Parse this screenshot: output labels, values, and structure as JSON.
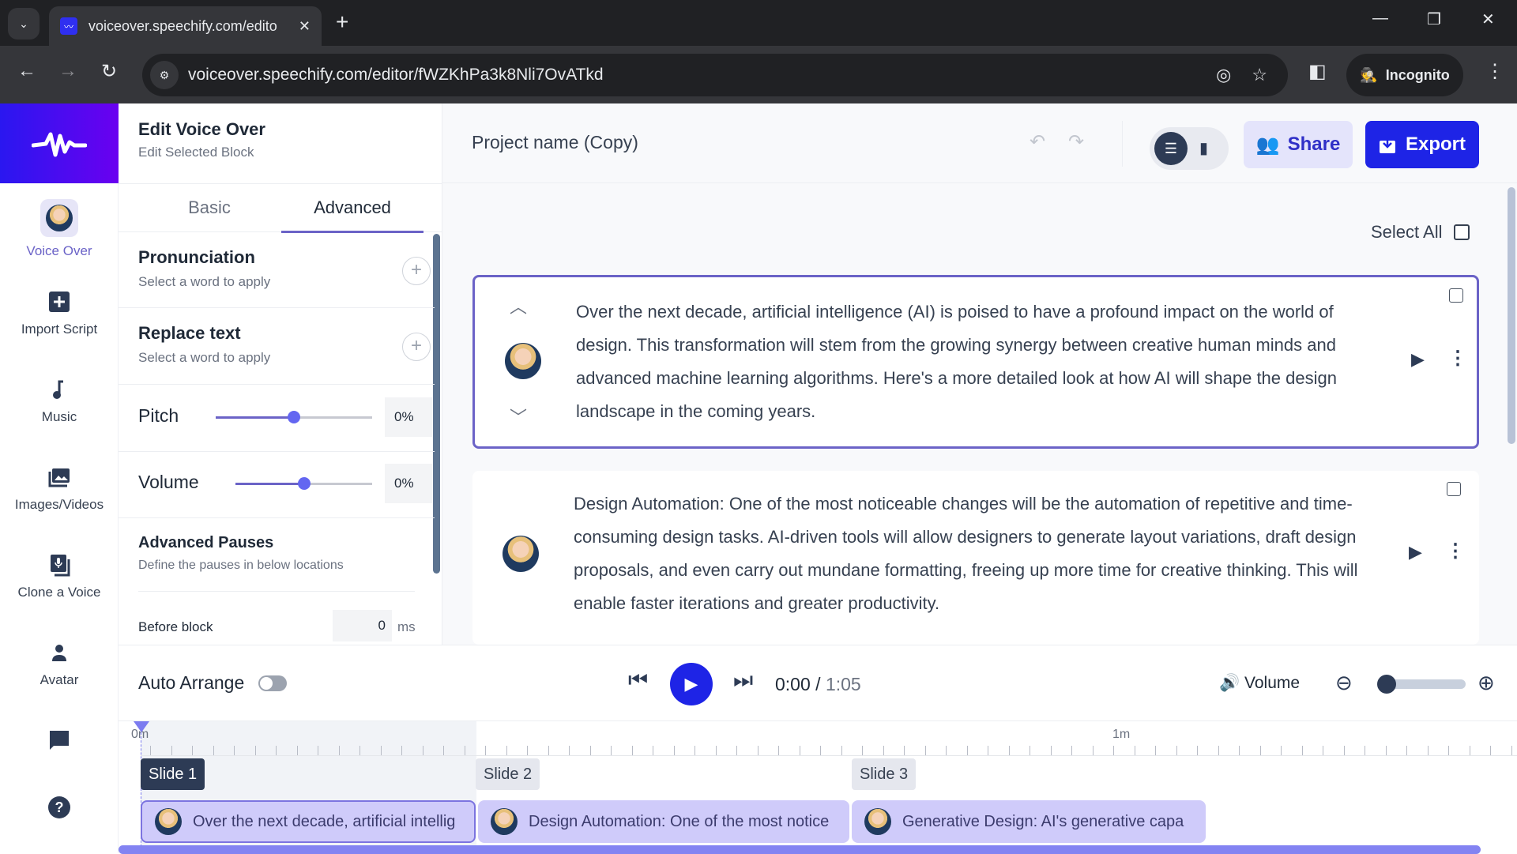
{
  "browser": {
    "tab_title": "voiceover.speechify.com/edito",
    "url": "voiceover.speechify.com/editor/fWZKhPa3k8Nli7OvATkd",
    "incognito_label": "Incognito"
  },
  "sidebar": {
    "items": [
      {
        "label": "Voice Over",
        "icon": "voice-avatar",
        "active": true
      },
      {
        "label": "Import Script",
        "icon": "plus-square-icon"
      },
      {
        "label": "Music",
        "icon": "music-note-icon"
      },
      {
        "label": "Images/Videos",
        "icon": "images-icon"
      },
      {
        "label": "Clone a Voice",
        "icon": "mic-icon"
      },
      {
        "label": "Avatar",
        "icon": "person-icon"
      },
      {
        "label": "",
        "icon": "chat-icon"
      },
      {
        "label": "",
        "icon": "help-icon"
      }
    ]
  },
  "left_panel": {
    "title": "Edit Voice Over",
    "subtitle": "Edit Selected Block",
    "tabs": [
      {
        "label": "Basic"
      },
      {
        "label": "Advanced",
        "active": true
      }
    ],
    "pronunciation": {
      "title": "Pronunciation",
      "subtitle": "Select a word to apply"
    },
    "replace_text": {
      "title": "Replace text",
      "subtitle": "Select a word to apply"
    },
    "pitch": {
      "label": "Pitch",
      "value": "0%",
      "slider_fraction": 0.5
    },
    "volume": {
      "label": "Volume",
      "value": "0%",
      "slider_fraction": 0.5
    },
    "advanced_pauses": {
      "title": "Advanced Pauses",
      "subtitle": "Define the pauses in below locations"
    },
    "before_block": {
      "label": "Before block",
      "value": "0",
      "unit": "ms"
    }
  },
  "header": {
    "project_name": "Project name (Copy)",
    "share_label": "Share",
    "export_label": "Export",
    "accent": "#1e24e6"
  },
  "editor": {
    "select_all_label": "Select All",
    "blocks": [
      {
        "text": "Over the next decade, artificial intelligence (AI) is poised to have a profound impact on the world of design. This transformation will stem from the growing synergy between creative human minds and advanced machine learning algorithms. Here's a more detailed look at how AI will shape the design landscape in the coming years.",
        "selected": true
      },
      {
        "text": "Design Automation: One of the most noticeable changes will be the automation of repetitive and time-consuming design tasks. AI-driven tools will allow designers to generate layout variations, draft design proposals, and even carry out mundane formatting, freeing up more time for creative thinking. This will enable faster iterations and greater productivity.",
        "selected": false
      }
    ]
  },
  "player": {
    "auto_arrange_label": "Auto Arrange",
    "auto_arrange_on": false,
    "current_time": "0:00",
    "separator": " / ",
    "total_time": "1:05",
    "volume_label": "Volume",
    "zoom_fraction": 0.0
  },
  "timeline": {
    "ruler_labels": [
      "0m",
      "1m"
    ],
    "slides": [
      {
        "label": "Slide 1",
        "active": true
      },
      {
        "label": "Slide 2"
      },
      {
        "label": "Slide 3"
      }
    ],
    "clips": [
      {
        "text": "Over the next decade, artificial intellig",
        "active": true
      },
      {
        "text": "Design Automation: One of the most notice"
      },
      {
        "text": "Generative Design: AI's generative capa"
      }
    ]
  }
}
